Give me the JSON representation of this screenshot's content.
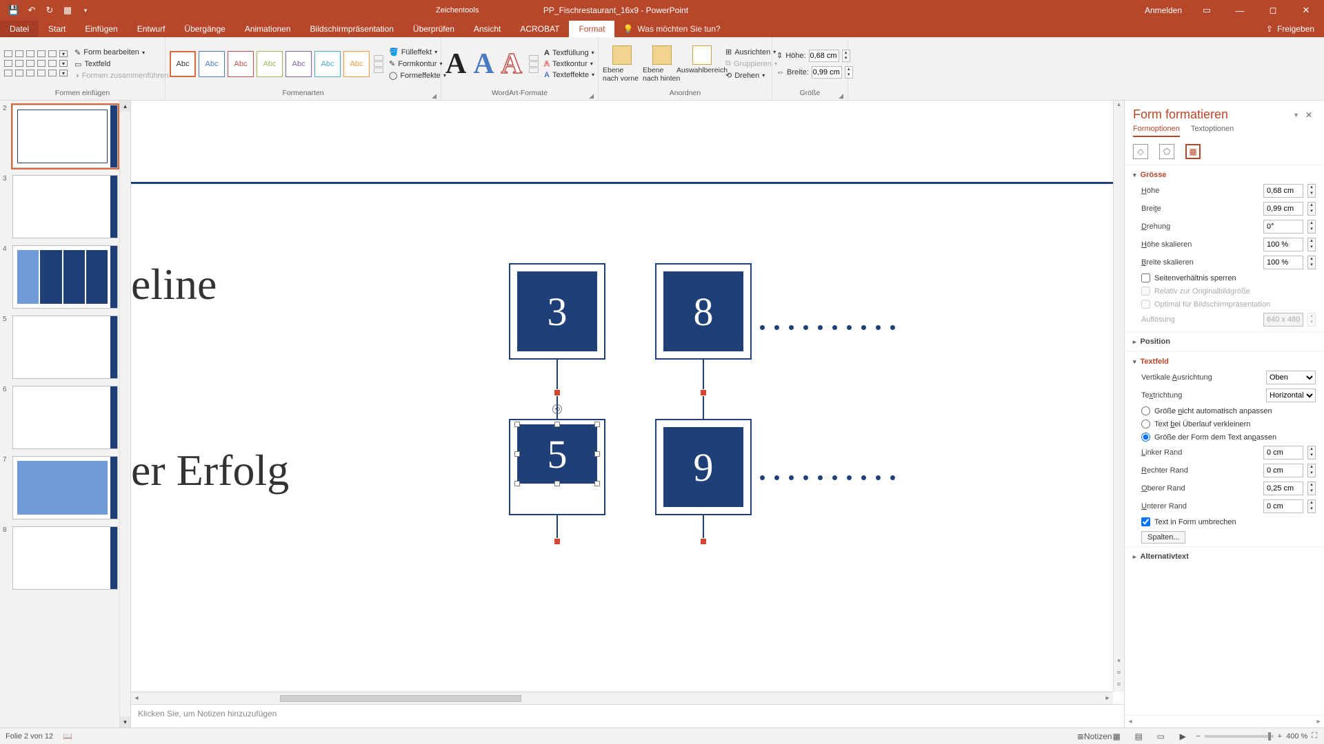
{
  "titlebar": {
    "doc_title": "PP_Fischrestaurant_16x9 - PowerPoint",
    "tools_context": "Zeichentools",
    "signin": "Anmelden"
  },
  "tabs": {
    "file": "Datei",
    "start": "Start",
    "insert": "Einfügen",
    "design": "Entwurf",
    "transitions": "Übergänge",
    "animations": "Animationen",
    "slideshow": "Bildschirmpräsentation",
    "review": "Überprüfen",
    "view": "Ansicht",
    "acrobat": "ACROBAT",
    "format": "Format",
    "tell_me": "Was möchten Sie tun?",
    "share": "Freigeben"
  },
  "ribbon": {
    "insert_shapes": {
      "label": "Formen einfügen",
      "edit_shape": "Form bearbeiten",
      "textbox": "Textfeld",
      "merge": "Formen zusammenführen"
    },
    "shape_styles": {
      "label": "Formenarten",
      "sample": "Abc",
      "fill": "Fülleffekt",
      "outline": "Formkontur",
      "effects": "Formeffekte"
    },
    "wordart": {
      "label": "WordArt-Formate",
      "textfill": "Textfüllung",
      "textoutline": "Textkontur",
      "texteffects": "Texteffekte"
    },
    "arrange": {
      "label": "Anordnen",
      "bring_forward": "Ebene nach vorne",
      "send_backward": "Ebene nach hinten",
      "selection_pane": "Auswahlbereich",
      "align": "Ausrichten",
      "group": "Gruppieren",
      "rotate": "Drehen"
    },
    "size": {
      "label": "Größe",
      "height_lbl": "Höhe:",
      "width_lbl": "Breite:",
      "height_val": "0,68 cm",
      "width_val": "0,99 cm"
    }
  },
  "slide": {
    "text1": "eline",
    "text2": "er Erfolg",
    "box3": "3",
    "box5": "5",
    "box8": "8",
    "box9": "9"
  },
  "notes_placeholder": "Klicken Sie, um Notizen hinzuzufügen",
  "pane": {
    "title": "Form formatieren",
    "tab_shape": "Formoptionen",
    "tab_text": "Textoptionen",
    "size_hdr": "Grösse",
    "height": "Höhe",
    "height_v": "0,68 cm",
    "width": "Breite",
    "width_v": "0,99 cm",
    "rotation": "Drehung",
    "rotation_v": "0°",
    "scale_h": "Höhe skalieren",
    "scale_h_v": "100 %",
    "scale_w": "Breite skalieren",
    "scale_w_v": "100 %",
    "lock_aspect": "Seitenverhältnis sperren",
    "rel_orig": "Relativ zur Originalbildgröße",
    "best_slideshow": "Optimal für Bildschirmpräsentation",
    "resolution": "Auflösung",
    "resolution_v": "640 x 480",
    "position_hdr": "Position",
    "textbox_hdr": "Textfeld",
    "valign": "Vertikale Ausrichtung",
    "valign_v": "Oben",
    "tdir": "Textrichtung",
    "tdir_v": "Horizontal",
    "autofit_none": "Größe nicht automatisch anpassen",
    "autofit_shrink": "Text bei Überlauf verkleinern",
    "autofit_resize": "Größe der Form dem Text anpassen",
    "margin_l": "Linker Rand",
    "margin_l_v": "0 cm",
    "margin_r": "Rechter Rand",
    "margin_r_v": "0 cm",
    "margin_t": "Oberer Rand",
    "margin_t_v": "0,25 cm",
    "margin_b": "Unterer Rand",
    "margin_b_v": "0 cm",
    "wrap": "Text in Form umbrechen",
    "columns": "Spalten...",
    "alt_hdr": "Alternativtext"
  },
  "status": {
    "slide_info": "Folie 2 von 12",
    "lang": "",
    "notes_btn": "Notizen",
    "zoom": "400 %"
  },
  "thumbs": [
    2,
    3,
    4,
    5,
    6,
    7,
    8
  ]
}
